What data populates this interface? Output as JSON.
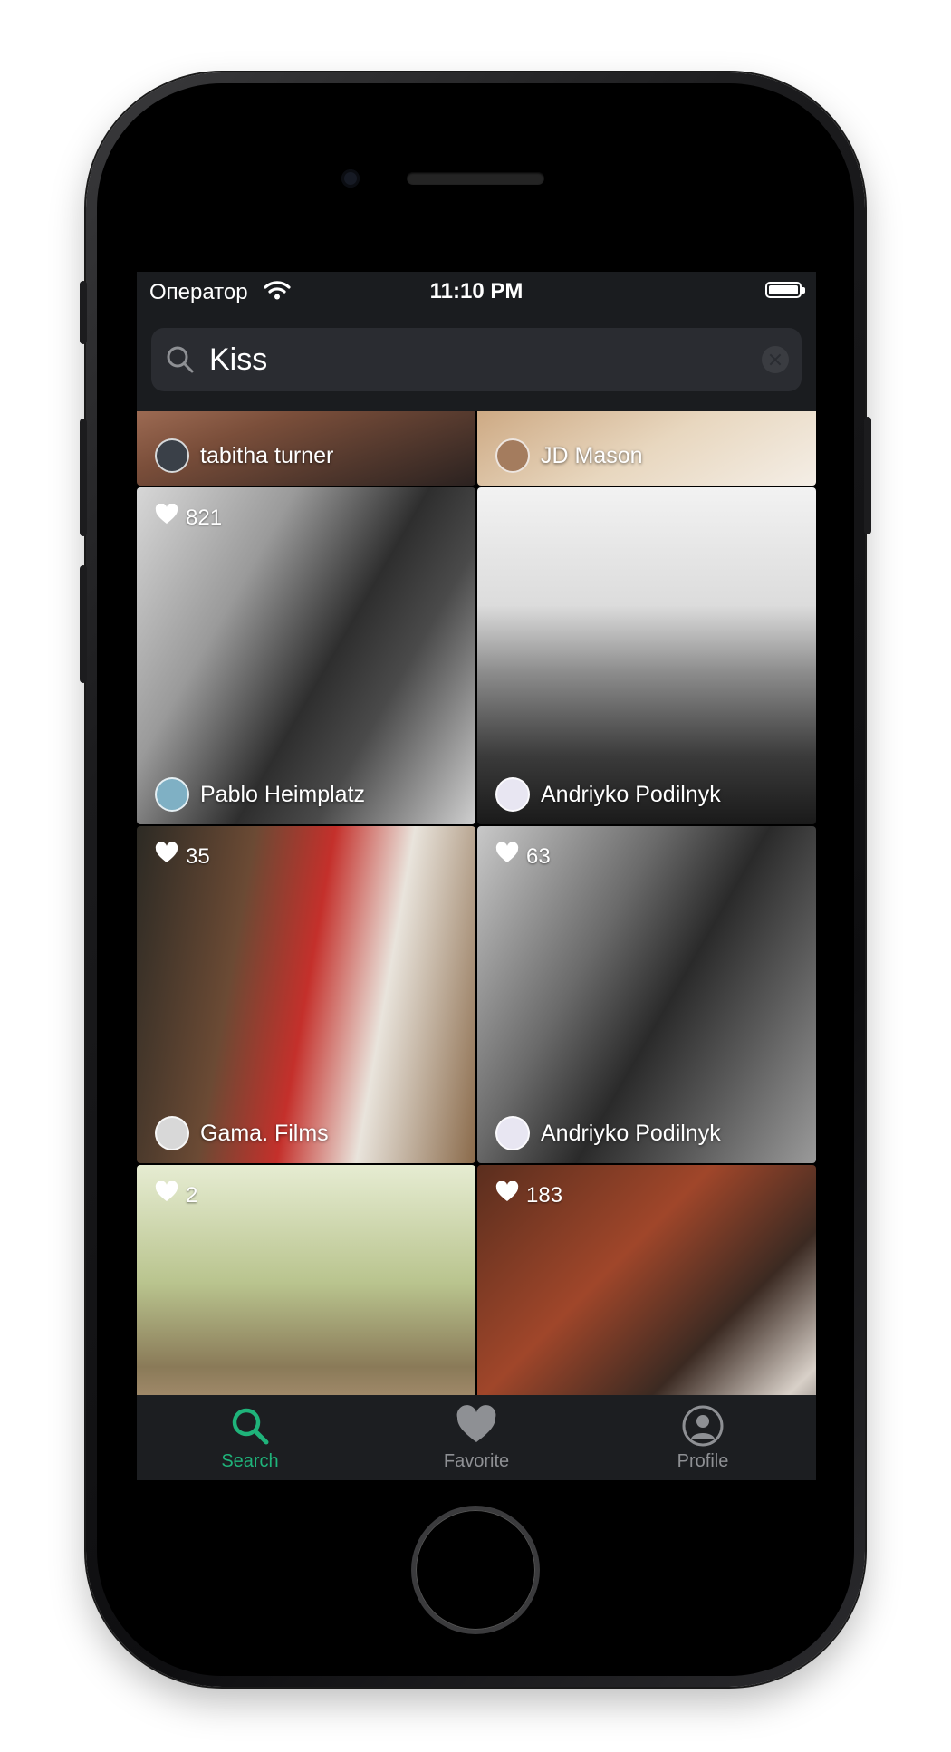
{
  "status_bar": {
    "carrier": "Оператор",
    "time": "11:10 PM"
  },
  "search": {
    "value": "Kiss",
    "placeholder": "Search"
  },
  "photos": [
    {
      "author": "tabitha turner",
      "likes": ""
    },
    {
      "author": "JD  Mason",
      "likes": ""
    },
    {
      "author": "Pablo Heimplatz",
      "likes": "821"
    },
    {
      "author": "Andriyko Podilnyk",
      "likes": ""
    },
    {
      "author": "Gama. Films",
      "likes": "35"
    },
    {
      "author": "Andriyko Podilnyk",
      "likes": "63"
    },
    {
      "author": "",
      "likes": "2"
    },
    {
      "author": "",
      "likes": "183"
    }
  ],
  "tabs": [
    {
      "label": "Search",
      "icon": "search-icon",
      "active": true
    },
    {
      "label": "Favorite",
      "icon": "heart-icon",
      "active": false
    },
    {
      "label": "Profile",
      "icon": "person-circle-icon",
      "active": false
    }
  ],
  "colors": {
    "accent": "#1fb37a",
    "background": "#1a1c1f",
    "search_field": "#2a2c31"
  }
}
